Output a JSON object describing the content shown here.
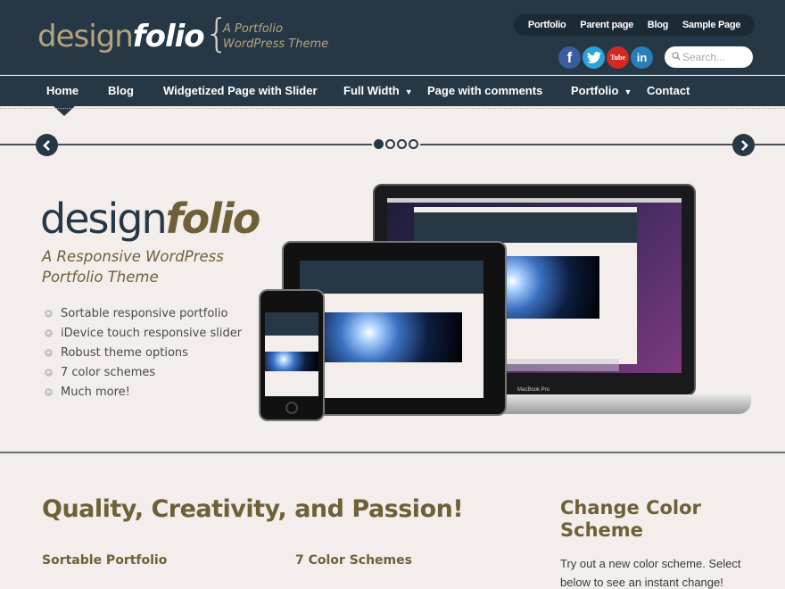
{
  "header": {
    "logo_part1": "design",
    "logo_part2": "folio",
    "brace": "{",
    "tagline_line1": "A Portfolio",
    "tagline_line2": "WordPress Theme",
    "top_menu": [
      "Portfolio",
      "Parent page",
      "Blog",
      "Sample Page"
    ],
    "social": [
      {
        "name": "facebook",
        "glyph": "f",
        "color": "#3b5c9e"
      },
      {
        "name": "twitter",
        "glyph": "🐦",
        "color": "#2aa3d8"
      },
      {
        "name": "youtube",
        "glyph": "Tube",
        "color": "#d22a22"
      },
      {
        "name": "linkedin",
        "glyph": "in",
        "color": "#2a7db5"
      }
    ],
    "search_placeholder": "Search..."
  },
  "nav": {
    "items": [
      {
        "label": "Home",
        "has_dropdown": false,
        "active": true
      },
      {
        "label": "Blog",
        "has_dropdown": false
      },
      {
        "label": "Widgetized Page with Slider",
        "has_dropdown": false
      },
      {
        "label": "Full Width",
        "has_dropdown": true
      },
      {
        "label": "Page with comments",
        "has_dropdown": false
      },
      {
        "label": "Portfolio",
        "has_dropdown": true
      },
      {
        "label": "Contact",
        "has_dropdown": false
      }
    ],
    "dropdown_glyph": "▼"
  },
  "slider": {
    "prev_glyph": "‹",
    "next_glyph": "›",
    "total_slides": 4,
    "active_slide": 1
  },
  "hero": {
    "logo_part1": "design",
    "logo_part2": "folio",
    "subtitle_line1": "A Responsive WordPress",
    "subtitle_line2": "Portfolio Theme",
    "features": [
      "Sortable responsive portfolio",
      "iDevice touch responsive slider",
      "Robust theme options",
      "7 color schemes",
      "Much more!"
    ],
    "laptop_label": "MacBook Pro"
  },
  "content": {
    "heading": "Quality, Creativity, and Passion!",
    "subheading1": "Sortable Portfolio",
    "subheading2": "7 Color Schemes"
  },
  "sidebar": {
    "title": "Change Color Scheme",
    "text": "Try out a new color scheme. Select below to see an instant change!"
  },
  "colors": {
    "header_bg": "#263846",
    "accent": "#6e6038",
    "logo_gold": "#b5a47e",
    "page_bg": "#f3eeeb"
  }
}
